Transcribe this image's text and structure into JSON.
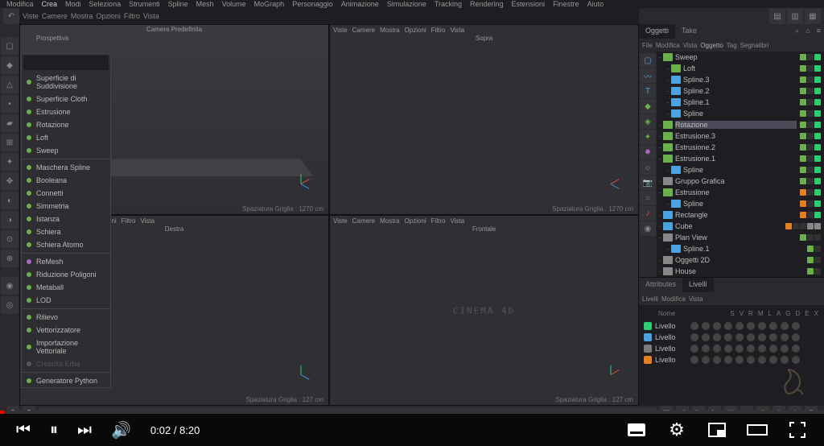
{
  "menubar": [
    "Modifica",
    "Crea",
    "Modi",
    "Seleziona",
    "Strumenti",
    "Spline",
    "Mesh",
    "Volume",
    "MoGraph",
    "Personaggio",
    "Animazione",
    "Simulazione",
    "Tracking",
    "Rendering",
    "Estensioni",
    "Finestre",
    "Aiuto"
  ],
  "axis": {
    "x": "X",
    "y": "Y",
    "z": "Z"
  },
  "vp_menu": [
    "Viste",
    "Camere",
    "Mostra",
    "Opzioni",
    "Filtro",
    "Vista"
  ],
  "viewports": {
    "tl": {
      "title": "Prospettiva",
      "cam": "Camera Predefinita",
      "grid": "Spaziatura Griglia : 1270 cm"
    },
    "tr": {
      "title": "Sopra",
      "grid": "Spaziatura Griglia : 1270 cm"
    },
    "bl": {
      "title": "Destra",
      "grid": "Spaziatura Griglia : 127 cm"
    },
    "br": {
      "title": "Frontale",
      "grid": "Spaziatura Griglia : 127 cm"
    }
  },
  "dropdown": [
    {
      "label": "Superficie di Suddivisione",
      "c": "green"
    },
    {
      "label": "Superficie Cloth",
      "c": "green"
    },
    {
      "label": "Estrusione",
      "c": "green"
    },
    {
      "label": "Rotazione",
      "c": "green"
    },
    {
      "label": "Loft",
      "c": "green"
    },
    {
      "label": "Sweep",
      "c": "green"
    },
    {
      "sep": true
    },
    {
      "label": "Maschera Spline",
      "c": "green"
    },
    {
      "label": "Booleana",
      "c": "green"
    },
    {
      "label": "Connetti",
      "c": "green"
    },
    {
      "label": "Simmetria",
      "c": "green"
    },
    {
      "label": "Istanza",
      "c": "green"
    },
    {
      "label": "Schiera",
      "c": "green"
    },
    {
      "label": "Schiera Atomo",
      "c": "green"
    },
    {
      "sep": true
    },
    {
      "label": "ReMesh",
      "c": "purple"
    },
    {
      "label": "Riduzione Poligoni",
      "c": "green"
    },
    {
      "label": "Metaball",
      "c": "green"
    },
    {
      "label": "LOD",
      "c": "green"
    },
    {
      "sep": true
    },
    {
      "label": "Rilievo",
      "c": "green"
    },
    {
      "label": "Vettorizzatore",
      "c": "green"
    },
    {
      "label": "Importazione Vettoriale",
      "c": "green"
    },
    {
      "label": "Crescita Erba",
      "disabled": true
    },
    {
      "sep": true
    },
    {
      "label": "Generatore Python",
      "c": "green"
    }
  ],
  "right_tabs": {
    "a": "Oggetti",
    "b": "Take"
  },
  "obj_toolbar": [
    "File",
    "Modifica",
    "Vista",
    "Oggetto",
    "Tag",
    "Segnalibri"
  ],
  "obj_tree": [
    {
      "i": 0,
      "n": "Sweep",
      "c": "#6ab04c",
      "tags": [
        "#6ab04c",
        null,
        "#2ecc71"
      ]
    },
    {
      "i": 1,
      "n": "Loft",
      "c": "#6ab04c",
      "tags": [
        "#6ab04c",
        null,
        "#2ecc71"
      ]
    },
    {
      "i": 1,
      "n": "Spline.3",
      "c": "#4aa3df",
      "tags": [
        "#6ab04c",
        null,
        "#2ecc71"
      ]
    },
    {
      "i": 1,
      "n": "Spline.2",
      "c": "#4aa3df",
      "tags": [
        "#6ab04c",
        null,
        "#2ecc71"
      ]
    },
    {
      "i": 1,
      "n": "Spline.1",
      "c": "#4aa3df",
      "tags": [
        "#6ab04c",
        null,
        "#2ecc71"
      ]
    },
    {
      "i": 1,
      "n": "Spline",
      "c": "#4aa3df",
      "tags": [
        "#6ab04c",
        null,
        "#2ecc71"
      ]
    },
    {
      "i": 0,
      "n": "Rotazione",
      "c": "#6ab04c",
      "hi": true,
      "tags": [
        "#6ab04c",
        null,
        "#2ecc71"
      ]
    },
    {
      "i": 0,
      "n": "Estrusione.3",
      "c": "#6ab04c",
      "tags": [
        "#6ab04c",
        null,
        "#2ecc71"
      ]
    },
    {
      "i": 0,
      "n": "Estrusione.2",
      "c": "#6ab04c",
      "tags": [
        "#6ab04c",
        null,
        "#2ecc71"
      ]
    },
    {
      "i": 0,
      "n": "Estrusione.1",
      "c": "#6ab04c",
      "tags": [
        "#6ab04c",
        null,
        "#2ecc71"
      ]
    },
    {
      "i": 1,
      "n": "Spline",
      "c": "#4aa3df",
      "tags": [
        "#6ab04c",
        null,
        "#2ecc71"
      ]
    },
    {
      "i": 0,
      "n": "Gruppo Grafica",
      "c": "#888",
      "tags": [
        "#6ab04c",
        null,
        "#2ecc71"
      ]
    },
    {
      "i": 0,
      "n": "Estrusione",
      "c": "#6ab04c",
      "tags": [
        "#e67e22",
        null,
        "#2ecc71"
      ]
    },
    {
      "i": 1,
      "n": "Spline",
      "c": "#4aa3df",
      "tags": [
        "#e67e22",
        null,
        "#2ecc71"
      ]
    },
    {
      "i": 0,
      "n": "Rectangle",
      "c": "#4aa3df",
      "tags": [
        "#e67e22",
        null,
        "#2ecc71"
      ]
    },
    {
      "i": 0,
      "n": "Cube",
      "c": "#4aa3df",
      "tags": [
        "#e67e22",
        null,
        null,
        "#888",
        "#888"
      ]
    },
    {
      "i": 0,
      "n": "Plan View",
      "c": "#888",
      "tags": [
        "#6ab04c",
        null,
        null
      ]
    },
    {
      "i": 1,
      "n": "Spline.1",
      "c": "#4aa3df",
      "tags": [
        "#6ab04c",
        null
      ]
    },
    {
      "i": 0,
      "n": "Oggetti 2D",
      "c": "#888",
      "tags": [
        "#6ab04c",
        null
      ]
    },
    {
      "i": 0,
      "n": "House",
      "c": "#888",
      "tags": [
        "#6ab04c",
        null
      ]
    }
  ],
  "attr_tabs": {
    "a": "Attributes",
    "b": "Livelli"
  },
  "attr_toolbar": [
    "Livelli",
    "Modifica",
    "Vista"
  ],
  "layer_head": [
    "S",
    "V",
    "R",
    "M",
    "L",
    "A",
    "G",
    "D",
    "E",
    "X"
  ],
  "layers": [
    {
      "name": "Livello",
      "color": "#2ecc71"
    },
    {
      "name": "Livello",
      "color": "#4aa3df"
    },
    {
      "name": "Livello",
      "color": "#7a7a7a"
    },
    {
      "name": "Livello",
      "color": "#e67e22"
    }
  ],
  "layer_label": "Nome",
  "c4d_text": "CINEMA 4D",
  "player": {
    "time": "0:02 / 8:20"
  }
}
